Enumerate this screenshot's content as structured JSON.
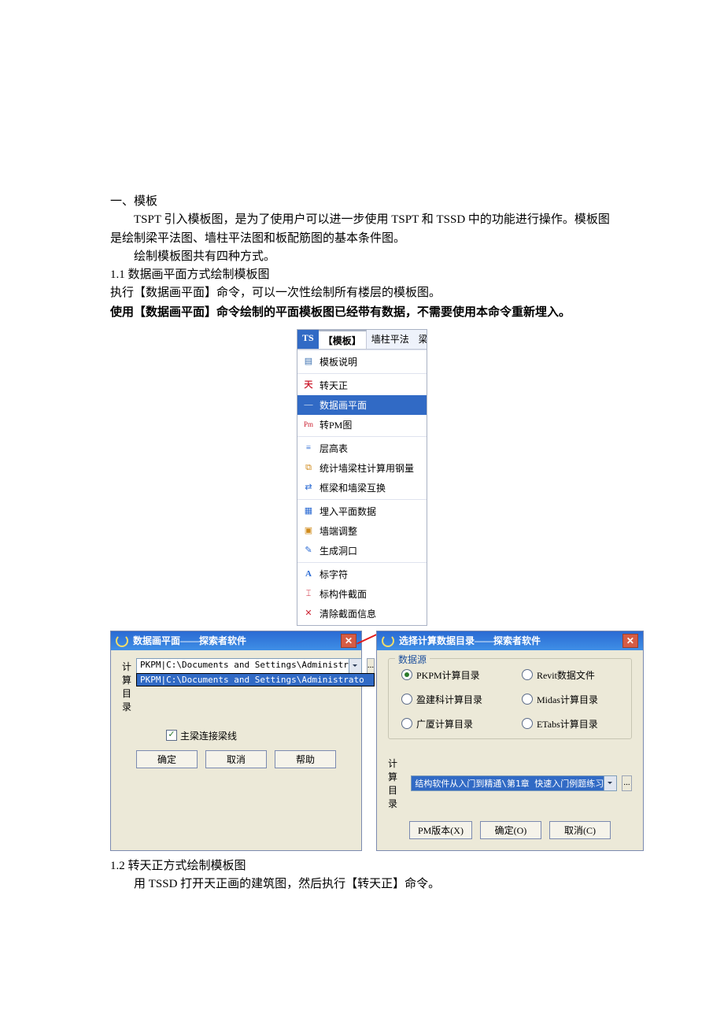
{
  "doc": {
    "h1": "一、模板",
    "p1": "TSPT 引入模板图，是为了使用户可以进一步使用 TSPT 和 TSSD 中的功能进行操作。模板图是绘制梁平法图、墙柱平法图和板配筋图的基本条件图。",
    "p2": "绘制模板图共有四种方式。",
    "s11": "1.1  数据画平面方式绘制模板图",
    "s11_l1": "执行【数据画平面】命令，可以一次性绘制所有楼层的模板图。",
    "s11_l2": "使用【数据画平面】命令绘制的平面模板图已经带有数据，不需要使用本命令重新埋入。",
    "s12": "1.2  转天正方式绘制模板图",
    "s12_l1": "用 TSSD 打开天正画的建筑图，然后执行【转天正】命令。"
  },
  "toolbar": {
    "ts": "TS",
    "tab_active": "【模板】",
    "tab2": "墙柱平法",
    "tab3": "梁平法",
    "items": [
      "模板说明",
      "转天正",
      "数据画平面",
      "转PM图",
      "层高表",
      "统计墙梁柱计算用钢量",
      "框梁和墙梁互换",
      "埋入平面数据",
      "墙端调整",
      "生成洞口",
      "标字符",
      "标构件截面",
      "清除截面信息"
    ]
  },
  "dlg1": {
    "title": "数据画平面——探索者软件",
    "dir_label": "计算目录",
    "dir_value": "PKPM|C:\\Documents and Settings\\Administr",
    "dir_option": "PKPM|C:\\Documents and Settings\\Administrato",
    "checkbox": "主梁连接梁线",
    "ok": "确定",
    "cancel": "取消",
    "help": "帮助",
    "browse": "..."
  },
  "dlg2": {
    "title": "选择计算数据目录——探索者软件",
    "group": "数据源",
    "radios": [
      "PKPM计算目录",
      "Revit数据文件",
      "盈建科计算目录",
      "Midas计算目录",
      "广厦计算目录",
      "ETabs计算目录"
    ],
    "dir_label": "计算目录",
    "dir_value": "结构软件从入门到精通\\第1章 快速入门例题练习",
    "browse": "...",
    "pm": "PM版本(X)",
    "ok": "确定(O)",
    "cancel": "取消(C)"
  }
}
